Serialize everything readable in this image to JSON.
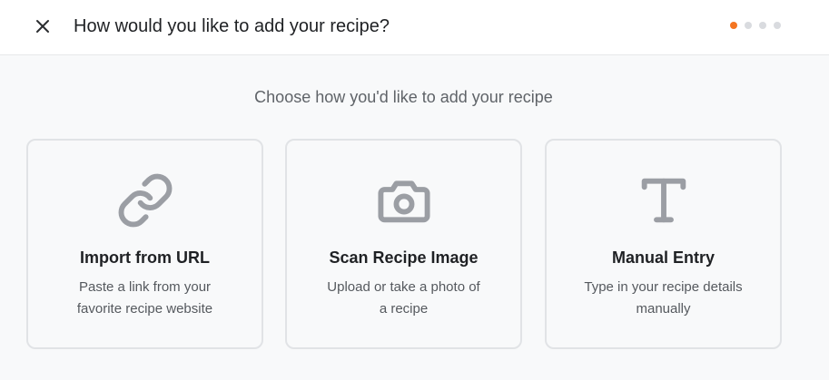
{
  "header": {
    "close_icon": "close-icon",
    "title": "How would you like to add your recipe?",
    "steps": {
      "total": 4,
      "current": 1,
      "active_color": "#f47521"
    }
  },
  "main": {
    "subtitle": "Choose how you'd like to add your recipe",
    "options": [
      {
        "icon": "link-icon",
        "title": "Import from URL",
        "description": "Paste a link from your favorite recipe website"
      },
      {
        "icon": "camera-icon",
        "title": "Scan Recipe Image",
        "description": "Upload or take a photo of a recipe"
      },
      {
        "icon": "text-icon",
        "title": "Manual Entry",
        "description": "Type in your recipe details manually"
      }
    ]
  }
}
